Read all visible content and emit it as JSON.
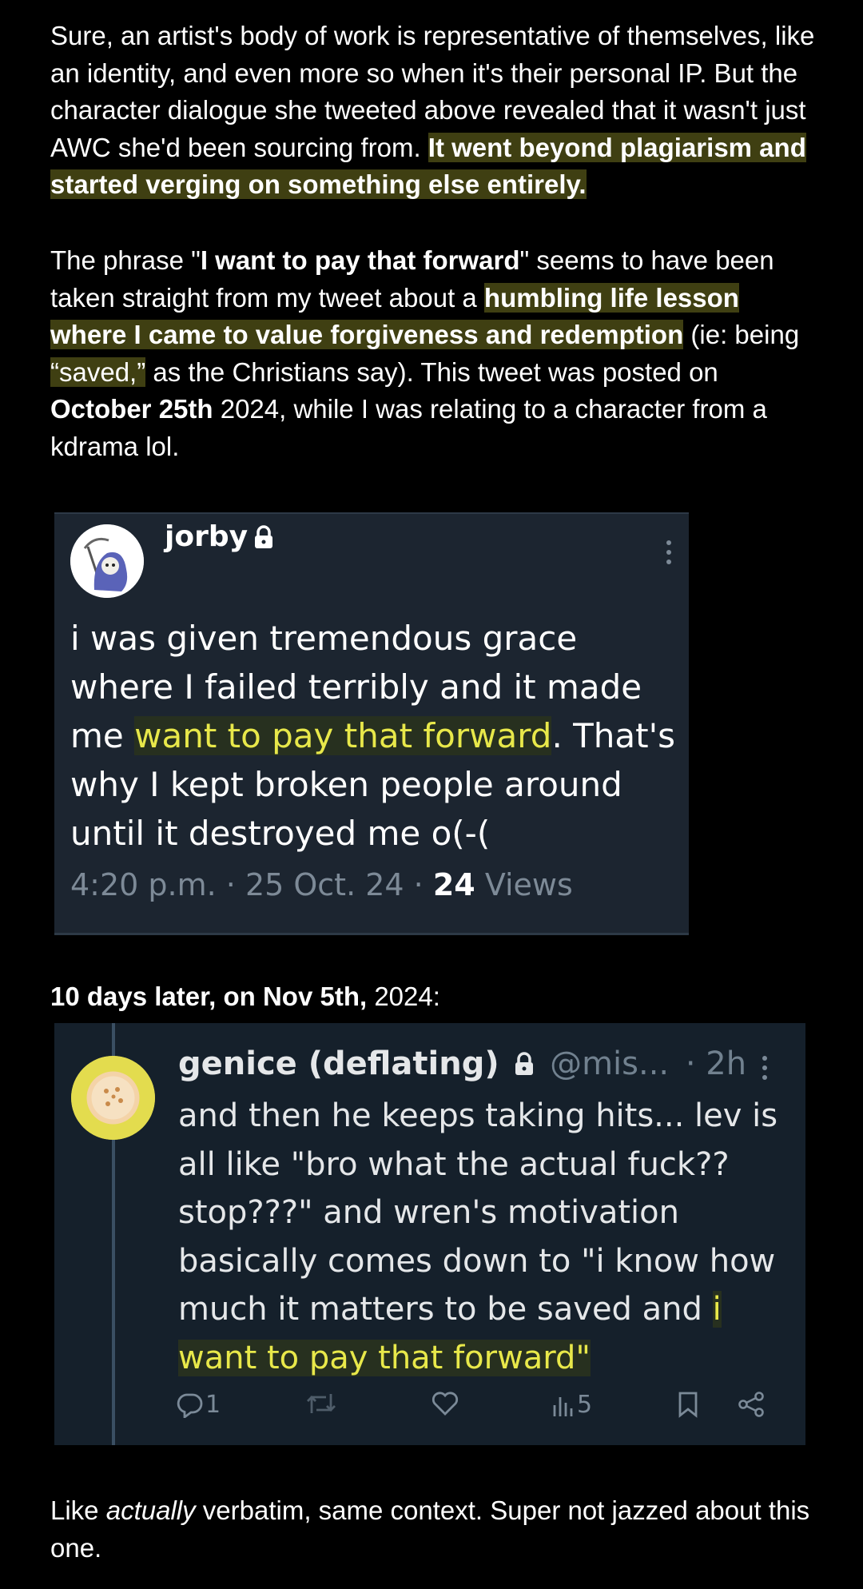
{
  "para1": {
    "line1": "Sure, an artist's body of work is representative of themselves, like an identity, and even more so when it's their personal IP. But the character dialogue she tweeted above revealed that it wasn't just AWC she'd been sourcing from. ",
    "highlight": "It went beyond plagiarism and started verging on something else entirely."
  },
  "para2": {
    "t1": "The phrase \"",
    "b1": "I want to pay that forward",
    "t2": "\" seems to have been taken straight from my tweet about a ",
    "h1": "humbling life lesson where I came to value forgiveness and redemption",
    "t3": " (ie: being ",
    "h2": "“saved,”",
    "t4": " as the Christians say). This tweet was posted on ",
    "b2": "October 25th",
    "t5": " 2024, while I was relating to a character from a kdrama lol."
  },
  "tweet1": {
    "name": "jorby",
    "text_a": "i was given tremendous grace where I failed terribly and it made me ",
    "text_hl": "want to pay that forward",
    "text_b": ". That's why I kept broken people around until it destroyed me o(-(",
    "meta_a": "4:20 p.m. · 25 Oct. 24 · ",
    "views_count": "24",
    "views_label": " Views"
  },
  "para3": {
    "bold": "10 days later, on Nov 5th,",
    "rest": " 2024:"
  },
  "tweet2": {
    "name": "genice (deflating)",
    "handle": "@mis...",
    "time": "· 2h",
    "text_a": "and then he keeps taking hits... lev is all like \"bro what the actual fuck?? stop???\" and wren's motivation basically comes down to \"i know how much it matters to be saved and ",
    "text_hl": "i want to pay that forward\"",
    "replies": "1",
    "views": "5"
  },
  "para4": {
    "t1": "Like ",
    "italic": "actually",
    "t2": " verbatim, same context. Super not jazzed about this one."
  },
  "icons": [
    "lock-icon",
    "more-icon",
    "reply-icon",
    "retweet-icon",
    "like-icon",
    "views-icon",
    "bookmark-icon",
    "share-icon"
  ],
  "colors": {
    "highlight_bg": "#3f3f12",
    "tweet_highlight": "#e8e84a",
    "card_bg": "#1c2530"
  }
}
